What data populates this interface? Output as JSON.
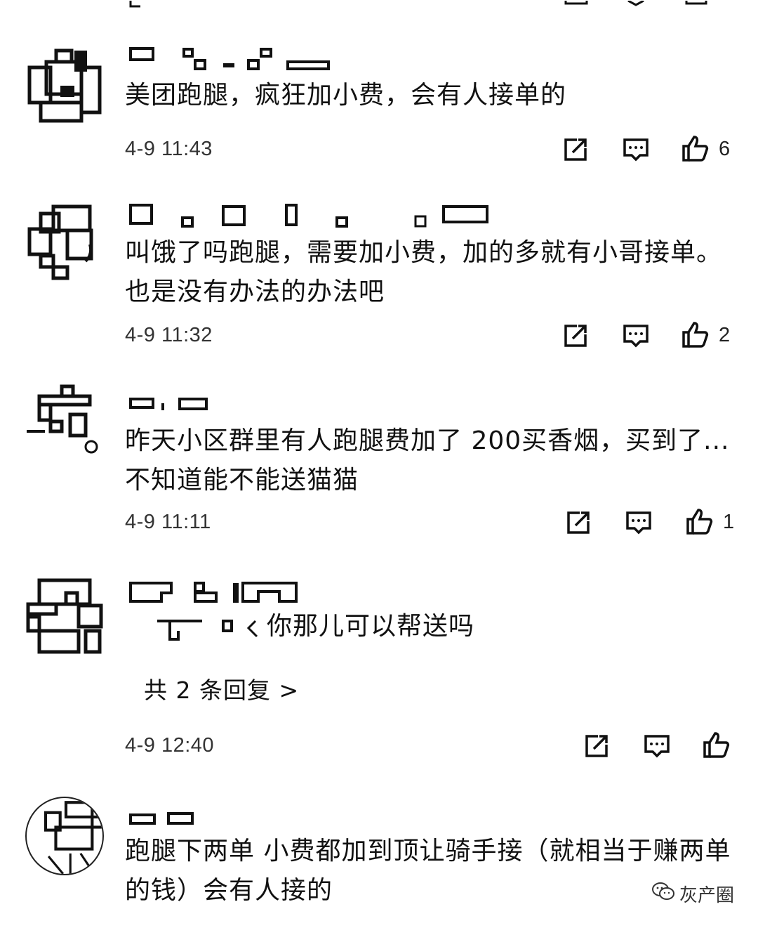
{
  "comments": [
    {
      "text": "美团跑腿，疯狂加小费，会有人接单的",
      "time": "4-9 11:43",
      "like_count": "6"
    },
    {
      "text": "叫饿了吗跑腿，需要加小费，加的多就有小哥接单。也是没有办法的办法吧",
      "time": "4-9 11:32",
      "like_count": "2"
    },
    {
      "text": "昨天小区群里有人跑腿费加了 200买香烟，买到了... 不知道能不能送猫猫",
      "time": "4-9 11:11",
      "like_count": "1"
    },
    {
      "text": "你那儿可以帮送吗",
      "replies_link": "共 2 条回复 >",
      "time": "4-9 12:40",
      "like_count": ""
    },
    {
      "text": "跑腿下两单 小费都加到顶让骑手接（就相当于赚两单的钱）会有人接的"
    }
  ],
  "icons": {
    "share": "share-icon",
    "comment": "comment-icon",
    "like": "thumbs-up-icon"
  },
  "watermark": {
    "label": "灰产圈",
    "icon": "wechat-icon"
  }
}
